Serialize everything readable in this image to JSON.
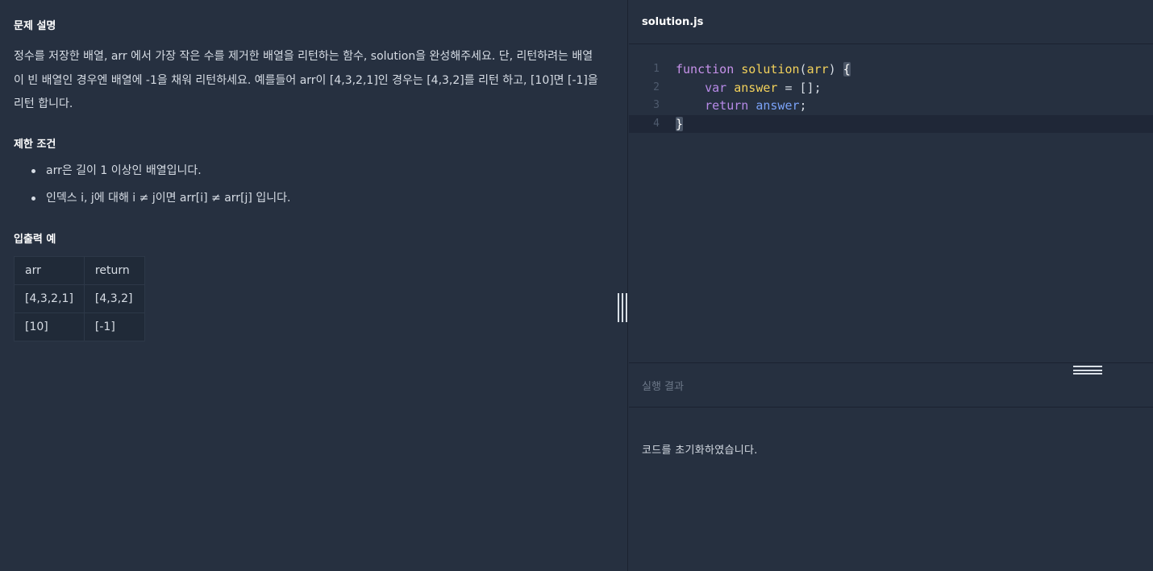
{
  "problem": {
    "heading": "문제 설명",
    "description": "정수를 저장한 배열, arr 에서 가장 작은 수를 제거한 배열을 리턴하는 함수, solution을 완성해주세요. 단, 리턴하려는 배열이 빈 배열인 경우엔 배열에 -1을 채워 리턴하세요. 예를들어 arr이 [4,3,2,1]인 경우는 [4,3,2]를 리턴 하고, [10]면 [-1]을 리턴 합니다.",
    "constraints_heading": "제한 조건",
    "constraints": [
      "arr은 길이 1 이상인 배열입니다.",
      "인덱스 i, j에 대해 i ≠ j이면 arr[i] ≠ arr[j] 입니다."
    ],
    "io_heading": "입출력 예",
    "io_table": {
      "headers": [
        "arr",
        "return"
      ],
      "rows": [
        [
          "[4,3,2,1]",
          "[4,3,2]"
        ],
        [
          "[10]",
          "[-1]"
        ]
      ]
    }
  },
  "editor": {
    "filename": "solution.js",
    "line_numbers": [
      "1",
      "2",
      "3",
      "4"
    ],
    "tokens": {
      "function_kw": "function",
      "fn_name": "solution",
      "open_paren": "(",
      "param": "arr",
      "close_paren": ")",
      "open_brace": "{",
      "var_kw": "var",
      "var_name": "answer",
      "assign": " = [];",
      "return_kw": "return",
      "return_ident": "answer",
      "semicolon": ";",
      "close_brace": "}"
    }
  },
  "result": {
    "title": "실행 결과",
    "message": "코드를 초기화하였습니다."
  },
  "colors": {
    "background": "#263040",
    "keyword": "#c792ea",
    "function_name": "#f2d15b",
    "identifier": "#7aa2f7"
  }
}
